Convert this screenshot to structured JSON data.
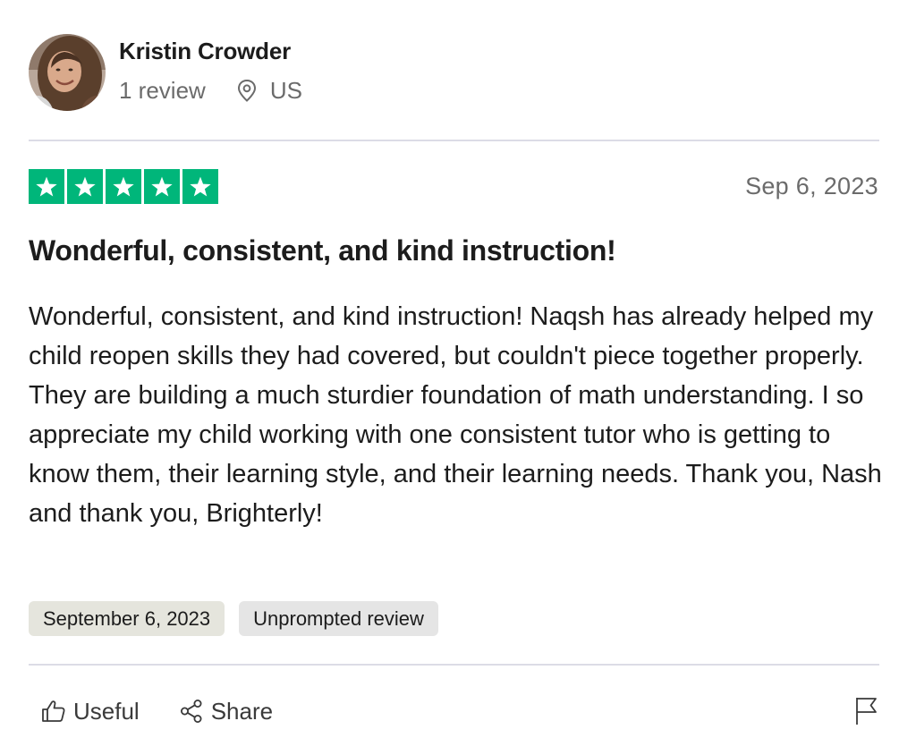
{
  "reviewer": {
    "name": "Kristin Crowder",
    "review_count": "1 review",
    "location": "US"
  },
  "rating": {
    "stars": 5,
    "out_of": 5,
    "color": "#00b67a"
  },
  "review": {
    "date": "Sep 6, 2023",
    "title": "Wonderful, consistent, and kind instruction!",
    "body": "Wonderful, consistent, and kind instruction! Naqsh has already helped my child reopen skills they had covered, but couldn't piece together properly. They are building a much sturdier foundation of math understanding. I so appreciate my child working with one consistent tutor who is getting to know them, their learning style, and their learning needs. Thank you, Nash and thank you, Brighterly!"
  },
  "tags": {
    "experience_date": "September 6, 2023",
    "review_type": "Unprompted review"
  },
  "actions": {
    "useful_label": "Useful",
    "share_label": "Share"
  },
  "icons": {
    "location": "location-pin-icon",
    "useful": "thumbs-up-icon",
    "share": "share-icon",
    "report": "flag-icon",
    "star": "star-icon"
  }
}
